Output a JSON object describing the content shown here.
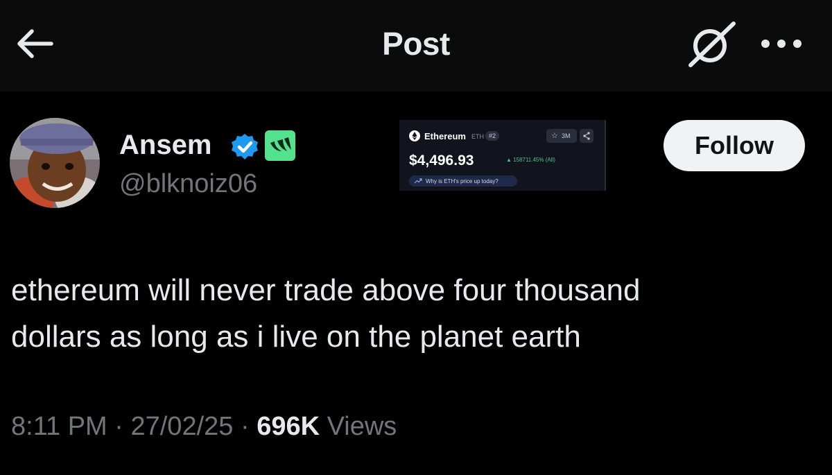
{
  "header": {
    "title": "Post",
    "back_icon": "arrow-left-icon",
    "grok_icon": "grok-icon",
    "more_icon": "more-dots-icon"
  },
  "author": {
    "display_name": "Ansem",
    "handle": "@blknoiz06",
    "verified_color": "#1d9bf0",
    "affiliate_badge_color": "#54e28e"
  },
  "follow_button": {
    "label": "Follow"
  },
  "eth_card": {
    "name": "Ethereum",
    "ticker": "ETH",
    "rank": "#2",
    "watchlist_count": "3M",
    "price": "$4,496.93",
    "change": "158711.45% (All)",
    "why_link": "Why is ETH's price up today?",
    "change_color": "#4cc38a"
  },
  "tweet": {
    "text_line1": "ethereum will never trade above four thousand",
    "text_line2": "dollars as long as i live on the planet earth"
  },
  "meta": {
    "time": "8:11 PM",
    "sep1": " · ",
    "date": "27/02/25",
    "sep2": " · ",
    "views_count": "696K",
    "views_label": " Views"
  }
}
